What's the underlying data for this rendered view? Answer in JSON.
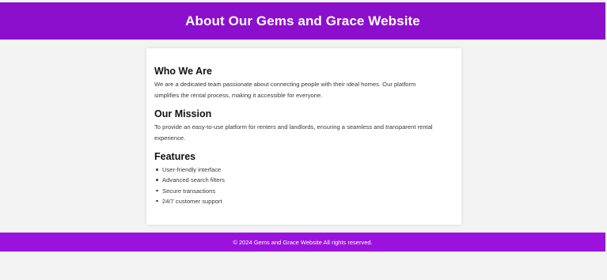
{
  "header": {
    "title": "About Our Gems and Grace Website"
  },
  "sections": [
    {
      "title": "Who We Are",
      "text": "We are a dedicated team passionate about connecting people with their ideal homes. Our platform simplifies the rental process, making it accessible for everyone."
    },
    {
      "title": "Our Mission",
      "text": "To provide an easy-to-use platform for renters and landlords, ensuring a seamless and transparent rental experience."
    },
    {
      "title": "Features",
      "items": [
        "User-friendly interface",
        "Advanced search filters",
        "Secure transactions",
        "24/7 customer support"
      ]
    }
  ],
  "footer": {
    "text": "© 2024 Gems and Grace Website All rights reserved."
  },
  "colors": {
    "header_bg": "#8b0fcc",
    "footer_bg": "#9b12de",
    "page_bg": "#f3f3f3",
    "card_bg": "#ffffff"
  }
}
